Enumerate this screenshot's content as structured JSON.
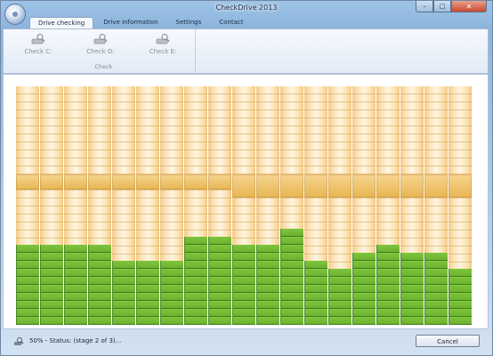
{
  "window": {
    "title": "CheckDrive 2013",
    "controls": {
      "minimize": "–",
      "maximize": "□",
      "close": "✕"
    }
  },
  "tabs": [
    {
      "label": "Drive checking",
      "active": true
    },
    {
      "label": "Drive information",
      "active": false
    },
    {
      "label": "Settings",
      "active": false
    },
    {
      "label": "Contact",
      "active": false
    }
  ],
  "ribbon": {
    "group_label": "Check",
    "buttons": [
      {
        "label": "Check C:",
        "icon": "drive-check-icon",
        "enabled": false
      },
      {
        "label": "Check D:",
        "icon": "drive-check-icon",
        "enabled": false
      },
      {
        "label": "Check E:",
        "icon": "drive-check-icon",
        "enabled": false
      }
    ]
  },
  "progress_grid": {
    "columns": 19,
    "rows": 30,
    "colors": {
      "pending": "#fbe2b4",
      "processing": "#e6b552",
      "done": "#6db131"
    },
    "green_rows_per_column": [
      10,
      10,
      10,
      10,
      8,
      8,
      8,
      11,
      11,
      10,
      10,
      12,
      8,
      7,
      9,
      10,
      9,
      9,
      7
    ],
    "band_rows": [
      2,
      2,
      2,
      2,
      2,
      2,
      2,
      2,
      2,
      3,
      3,
      3,
      3,
      3,
      3,
      3,
      3,
      3,
      3
    ]
  },
  "status": {
    "icon": "magnifier-drive-icon",
    "text": "50% - Status: (stage 2 of 3)...",
    "progress_percent": 50
  },
  "cancel_label": "Cancel"
}
